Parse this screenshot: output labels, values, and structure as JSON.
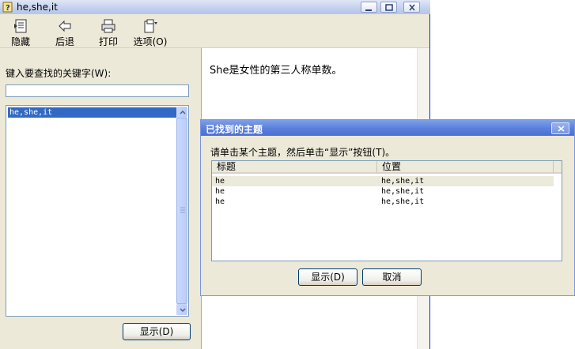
{
  "window": {
    "title": "he,she,it"
  },
  "toolbar": {
    "hide": "隐藏",
    "back": "后退",
    "print": "打印",
    "options": "选项(O)"
  },
  "index": {
    "keyword_label": "键入要查找的关键字(W):",
    "keyword_value": "",
    "items": [
      "he,she,it"
    ],
    "display_button": "显示(D)"
  },
  "content": {
    "text": "She是女性的第三人称单数。"
  },
  "dialog": {
    "title": "已找到的主题",
    "instruction": "请单击某个主题，然后单击“显示”按钮(T)。",
    "columns": [
      "标题",
      "位置"
    ],
    "rows": [
      {
        "title": "he",
        "location": "he,she,it"
      },
      {
        "title": "he",
        "location": "he,she,it"
      },
      {
        "title": "he",
        "location": "he,she,it"
      }
    ],
    "display_button": "显示(D)",
    "cancel_button": "取消"
  }
}
